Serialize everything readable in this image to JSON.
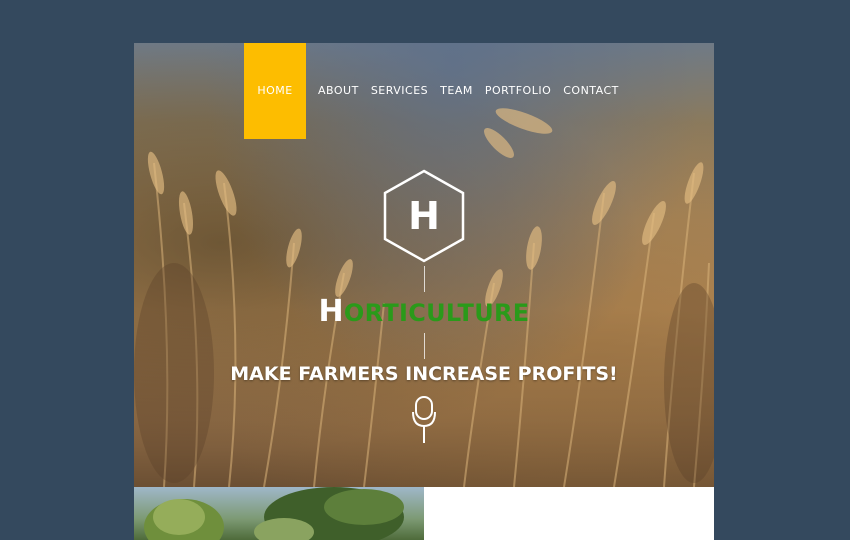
{
  "nav": {
    "items": [
      {
        "label": "HOME",
        "active": true
      },
      {
        "label": "ABOUT",
        "active": false
      },
      {
        "label": "SERVICES",
        "active": false
      },
      {
        "label": "TEAM",
        "active": false
      },
      {
        "label": "PORTFOLIO",
        "active": false
      },
      {
        "label": "CONTACT",
        "active": false
      }
    ]
  },
  "logo": {
    "letter": "H",
    "icon": "hexagon-logo-icon"
  },
  "hero": {
    "title_first_letter": "H",
    "title_rest": "ORTICULTURE",
    "tagline": "MAKE FARMERS INCREASE PROFITS!",
    "scroll_icon": "microphone-icon"
  },
  "colors": {
    "page_background": "#34495e",
    "nav_active": "#fdbd00",
    "title_green": "#2a9a1a",
    "text_white": "#ffffff"
  }
}
